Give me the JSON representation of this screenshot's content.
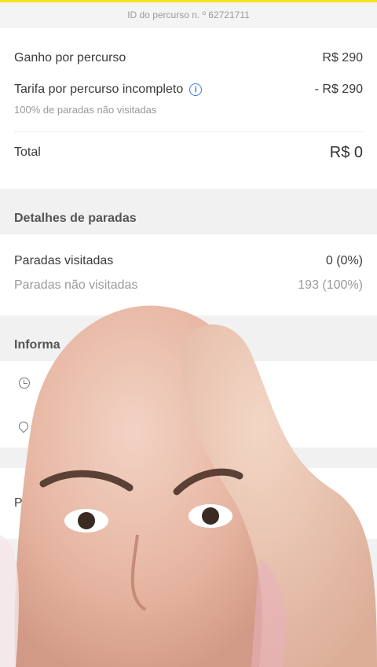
{
  "route_id": "ID do percurso n. º 62721711",
  "earnings": {
    "gain_label": "Ganho por percurso",
    "gain_value": "R$ 290",
    "fee_label": "Tarifa por percurso incompleto",
    "fee_value": "- R$ 290",
    "fee_note": "100% de paradas não visitadas",
    "info_icon": "info-icon",
    "total_label": "Total",
    "total_value": "R$ 0"
  },
  "stops": {
    "section_title": "Detalhes de paradas",
    "visited_label": "Paradas visitadas",
    "visited_value": "0 (0%)",
    "not_visited_label": "Paradas não visitadas",
    "not_visited_value": "193 (100%)"
  },
  "info": {
    "section_title": "Informa",
    "clock_icon": "clock-icon",
    "pin_icon": "map-pin-icon"
  },
  "partial_text": "Pr",
  "colors": {
    "top_accent": "#f6e41c",
    "info_blue": "#3d7be0"
  }
}
